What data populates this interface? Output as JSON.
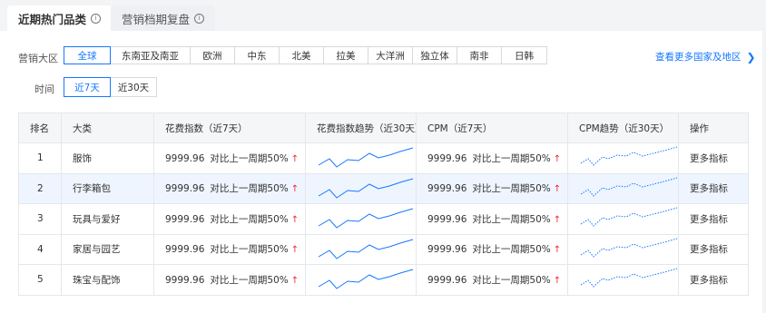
{
  "tabs": [
    {
      "label": "近期热门品类",
      "active": true
    },
    {
      "label": "营销档期复盘",
      "active": false
    }
  ],
  "filters": {
    "region_label": "营销大区",
    "regions": [
      "全球",
      "东南亚及南亚",
      "欧洲",
      "中东",
      "北美",
      "拉美",
      "大洋洲",
      "独立体",
      "南非",
      "日韩"
    ],
    "region_selected": "全球",
    "time_label": "时间",
    "times": [
      "近7天",
      "近30天"
    ],
    "time_selected": "近7天"
  },
  "more_countries_link": "查看更多国家及地区",
  "table": {
    "headers": [
      "排名",
      "大类",
      "花费指数（近7天）",
      "花费指数趋势（近30天）",
      "CPM（近7天）",
      "CPM趋势（近30天）",
      "操作"
    ],
    "rows": [
      {
        "rank": "1",
        "category": "服饰",
        "spend": "9999.96",
        "spend_cmp": "对比上一周期50%",
        "cpm": "9999.96",
        "cpm_cmp": "对比上一周期50%",
        "action": "更多指标",
        "highlighted": false
      },
      {
        "rank": "2",
        "category": "行李箱包",
        "spend": "9999.96",
        "spend_cmp": "对比上一周期50%",
        "cpm": "9999.96",
        "cpm_cmp": "对比上一周期50%",
        "action": "更多指标",
        "highlighted": true
      },
      {
        "rank": "3",
        "category": "玩具与爱好",
        "spend": "9999.96",
        "spend_cmp": "对比上一周期50%",
        "cpm": "9999.96",
        "cpm_cmp": "对比上一周期50%",
        "action": "更多指标",
        "highlighted": false
      },
      {
        "rank": "4",
        "category": "家居与园艺",
        "spend": "9999.96",
        "spend_cmp": "对比上一周期50%",
        "cpm": "9999.96",
        "cpm_cmp": "对比上一周期50%",
        "action": "更多指标",
        "highlighted": false
      },
      {
        "rank": "5",
        "category": "珠宝与配饰",
        "spend": "9999.96",
        "spend_cmp": "对比上一周期50%",
        "cpm": "9999.96",
        "cpm_cmp": "对比上一周期50%",
        "action": "更多指标",
        "highlighted": false
      }
    ]
  },
  "icons": {
    "tab_info": "info-circle-icon",
    "trend_up": "arrow-up-icon",
    "more_link": "chevron-right-icon"
  },
  "colors": {
    "accent": "#1677ff",
    "up_arrow": "#f5222d",
    "highlight_row": "#eef5ff",
    "header_bg": "#f5f6f8"
  }
}
